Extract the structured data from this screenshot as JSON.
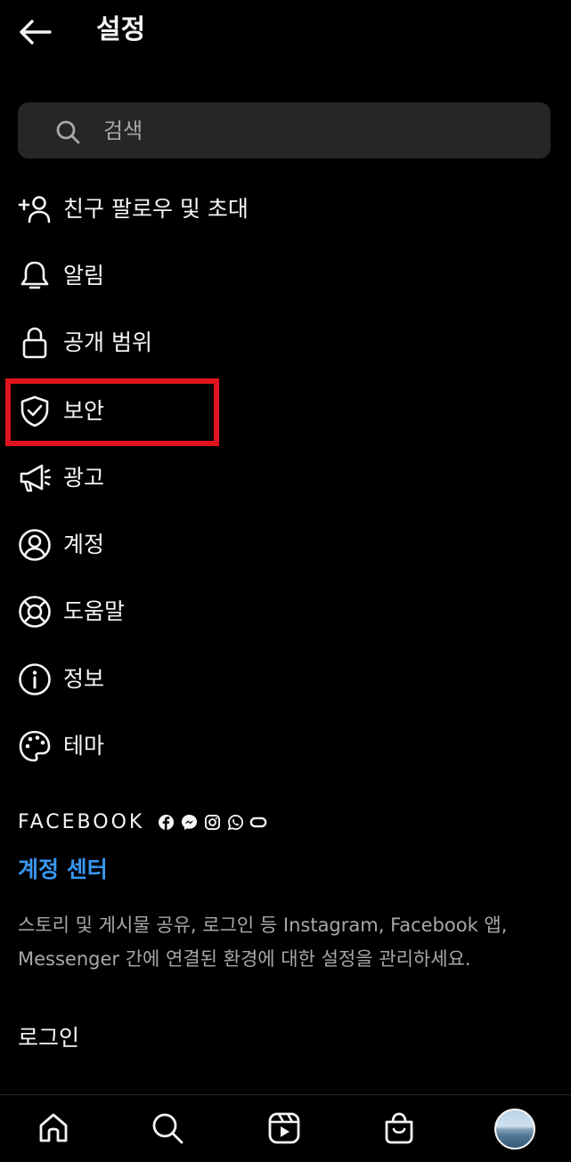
{
  "header": {
    "title": "설정"
  },
  "search": {
    "placeholder": "검색"
  },
  "menu": [
    {
      "label": "친구 팔로우 및 초대",
      "icon": "add-person-icon"
    },
    {
      "label": "알림",
      "icon": "bell-icon"
    },
    {
      "label": "공개 범위",
      "icon": "lock-icon"
    },
    {
      "label": "보안",
      "icon": "shield-check-icon"
    },
    {
      "label": "광고",
      "icon": "megaphone-icon"
    },
    {
      "label": "계정",
      "icon": "user-circle-icon"
    },
    {
      "label": "도움말",
      "icon": "lifebuoy-icon"
    },
    {
      "label": "정보",
      "icon": "info-icon"
    },
    {
      "label": "테마",
      "icon": "palette-icon"
    }
  ],
  "facebook": {
    "brand": "FACEBOOK",
    "icons": [
      "facebook-icon",
      "messenger-icon",
      "instagram-icon",
      "whatsapp-icon",
      "oculus-icon"
    ],
    "accounts_center": "계정 센터",
    "description": "스토리 및 게시물 공유, 로그인 등 Instagram, Facebook 앱, Messenger 간에 연결된 환경에 대한 설정을 관리하세요."
  },
  "login": {
    "label": "로그인"
  },
  "bottom_nav": [
    "home-icon",
    "search-icon",
    "reels-icon",
    "shop-icon",
    "profile-avatar"
  ],
  "colors": {
    "background": "#000000",
    "link": "#3897f0",
    "highlight": "#e0141e",
    "search_bg": "#262626"
  }
}
